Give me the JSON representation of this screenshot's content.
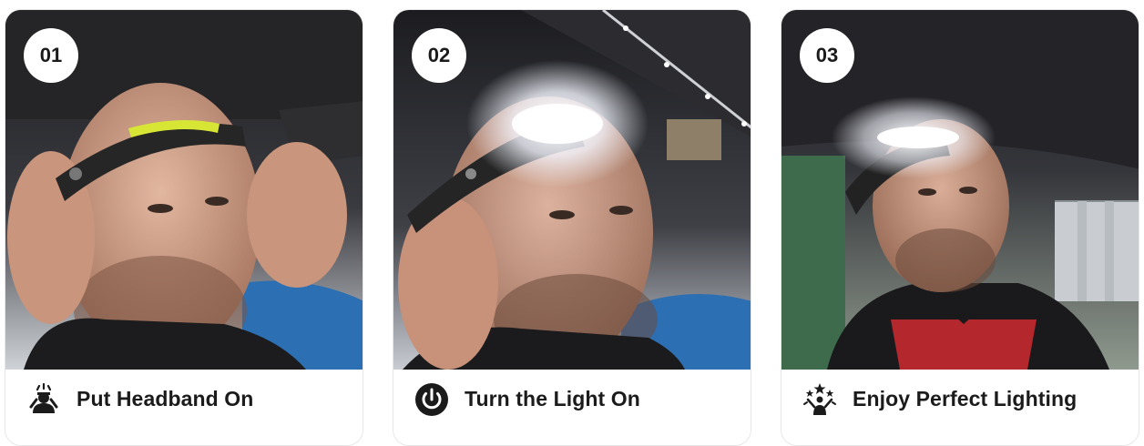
{
  "steps": [
    {
      "number": "01",
      "title": "Put Headband On",
      "icon": "person-headband-icon"
    },
    {
      "number": "02",
      "title": "Turn the Light On",
      "icon": "power-icon"
    },
    {
      "number": "03",
      "title": "Enjoy Perfect Lighting",
      "icon": "celebrate-icon"
    }
  ],
  "colors": {
    "text": "#1b1b1b",
    "badge_bg": "#ffffff",
    "light_strip": "#d7e635",
    "led_glow": "#f4f6ff"
  }
}
